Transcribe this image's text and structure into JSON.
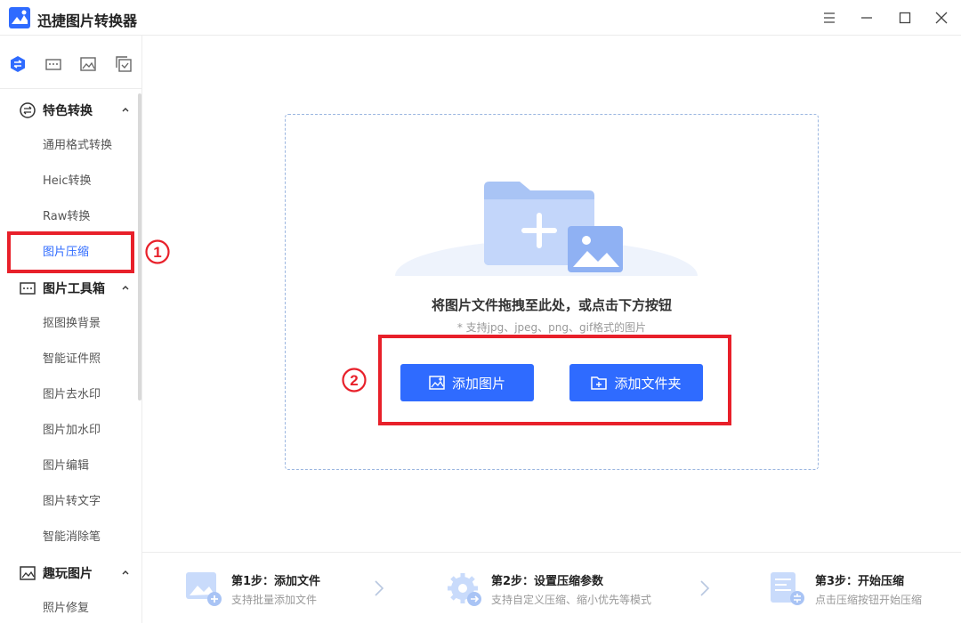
{
  "app": {
    "title": "迅捷图片转换器"
  },
  "sidebar": {
    "groups": [
      {
        "label": "特色转换",
        "items": [
          "通用格式转换",
          "Heic转换",
          "Raw转换",
          "图片压缩"
        ]
      },
      {
        "label": "图片工具箱",
        "items": [
          "抠图换背景",
          "智能证件照",
          "图片去水印",
          "图片加水印",
          "图片编辑",
          "图片转文字",
          "智能消除笔"
        ]
      },
      {
        "label": "趣玩图片",
        "items": [
          "照片修复"
        ]
      }
    ],
    "active_item": "图片压缩"
  },
  "annotations": {
    "marker1": "①",
    "marker2": "②"
  },
  "dropzone": {
    "title": "将图片文件拖拽至此处，或点击下方按钮",
    "subtitle": "* 支持jpg、jpeg、png、gif格式的图片",
    "add_image_label": "添加图片",
    "add_folder_label": "添加文件夹"
  },
  "steps": [
    {
      "title": "第1步：添加文件",
      "desc": "支持批量添加文件"
    },
    {
      "title": "第2步：设置压缩参数",
      "desc": "支持自定义压缩、缩小优先等模式"
    },
    {
      "title": "第3步：开始压缩",
      "desc": "点击压缩按钮开始压缩"
    }
  ],
  "colors": {
    "accent": "#2f6bff",
    "highlight": "#e8202a",
    "dashed_border": "#9bb6e0"
  }
}
